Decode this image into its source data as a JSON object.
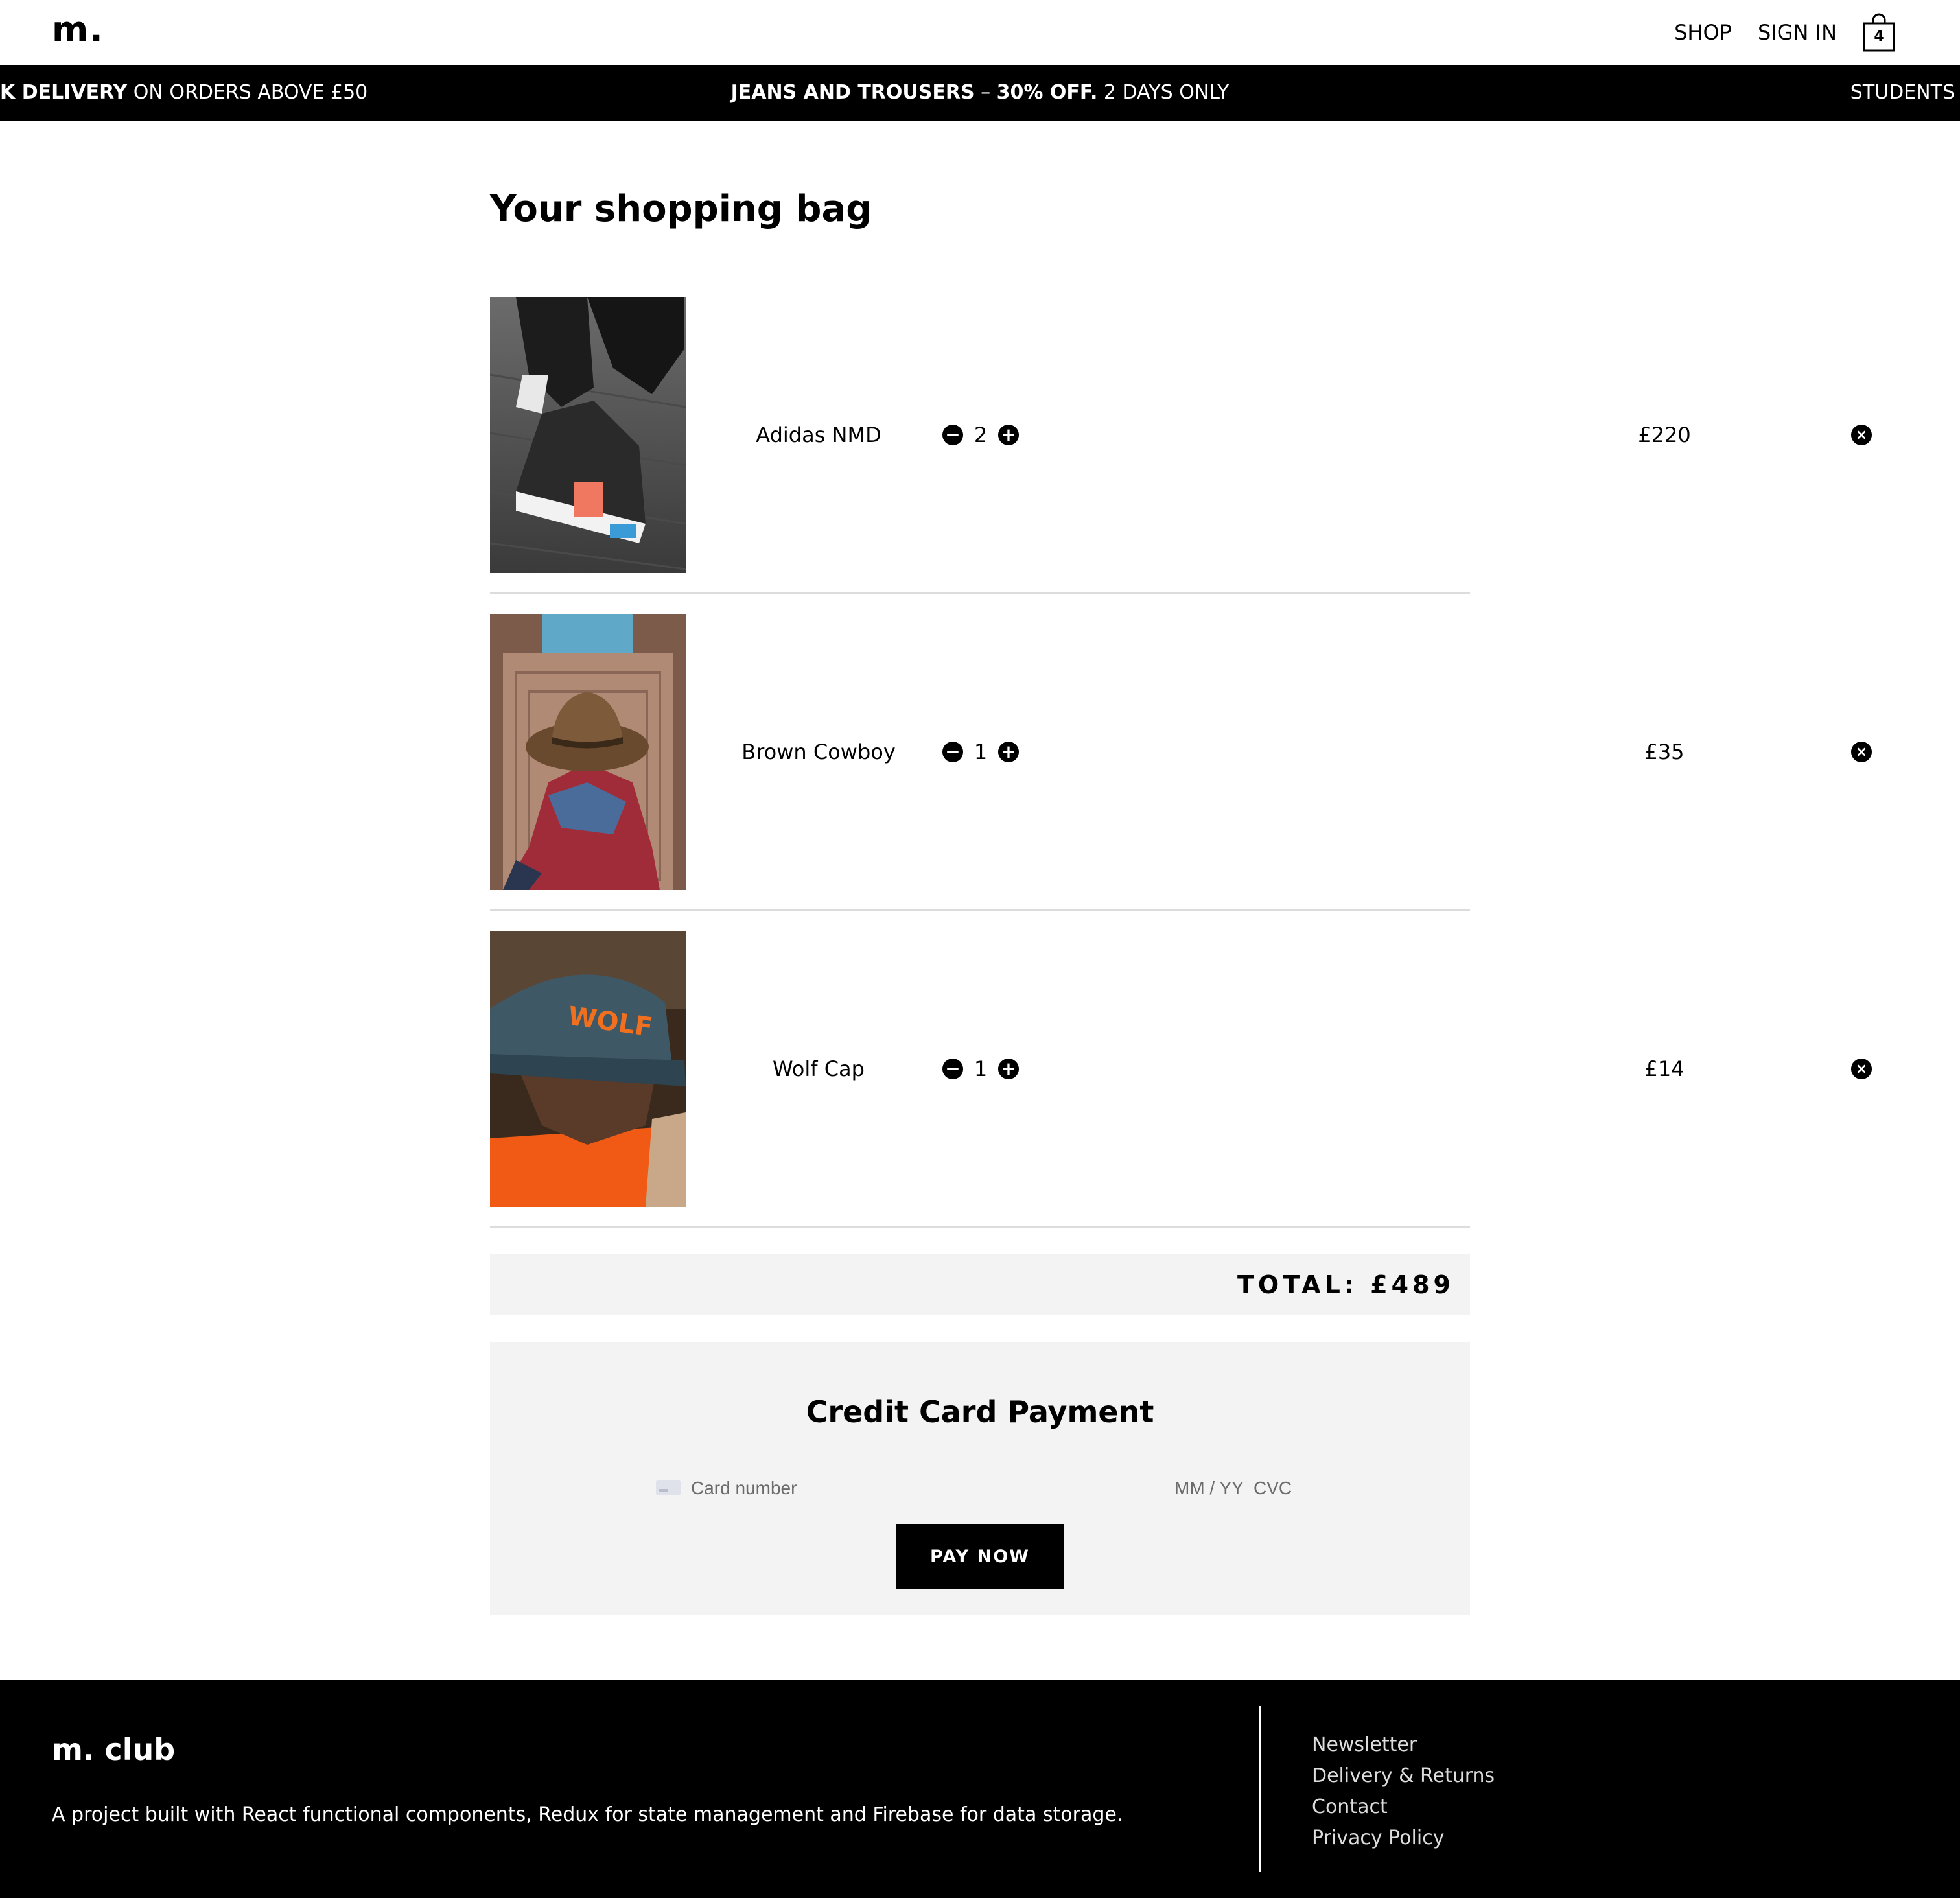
{
  "header": {
    "logo": "m.",
    "nav": {
      "shop": "SHOP",
      "sign_in": "SIGN IN"
    },
    "bag_count": "4"
  },
  "promo": {
    "left_bold": "K DELIVERY",
    "left_rest": " ON ORDERS ABOVE £50",
    "center_bold": "JEANS AND TROUSERS",
    "center_dash": " – ",
    "center_bold2": "30% OFF.",
    "center_rest": " 2 DAYS ONLY",
    "right": "STUDENTS"
  },
  "page_title": "Your shopping bag",
  "cart": {
    "items": [
      {
        "name": "Adidas NMD",
        "qty": "2",
        "price": "£220"
      },
      {
        "name": "Brown Cowboy",
        "qty": "1",
        "price": "£35"
      },
      {
        "name": "Wolf Cap",
        "qty": "1",
        "price": "£14"
      }
    ],
    "total": "TOTAL: £489"
  },
  "payment": {
    "title": "Credit Card Payment",
    "card_placeholder": "Card number",
    "exp_placeholder": "MM / YY",
    "cvc_placeholder": "CVC",
    "button": "PAY NOW"
  },
  "footer": {
    "title": "m. club",
    "description": "A project built with React functional components, Redux for state management and Firebase for data storage.",
    "links": [
      "Newsletter",
      "Delivery & Returns",
      "Contact",
      "Privacy Policy"
    ]
  },
  "icons": {
    "minus": "−",
    "plus": "+",
    "remove": "×"
  }
}
